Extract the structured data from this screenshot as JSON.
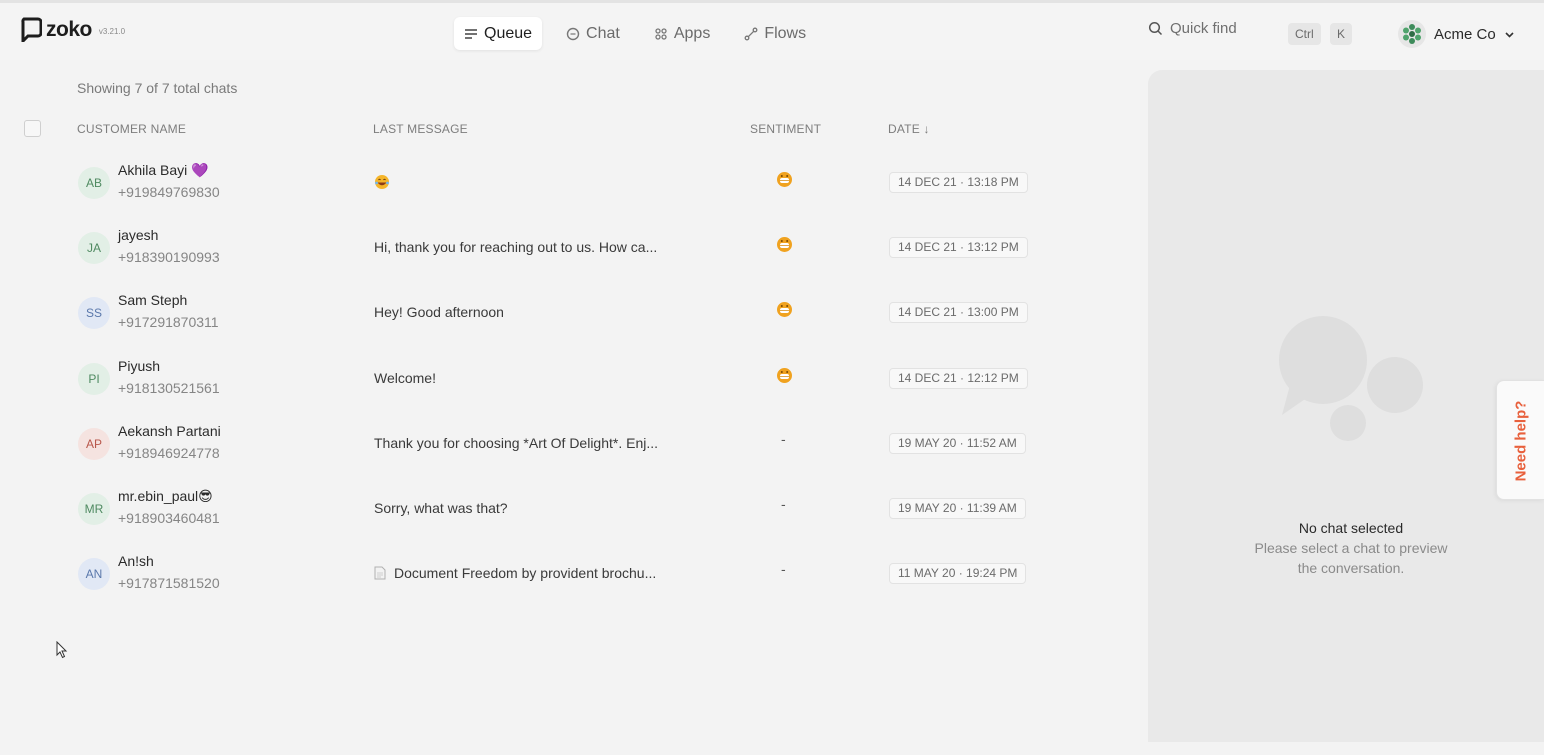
{
  "brand": {
    "name": "zoko",
    "version": "v3.21.0"
  },
  "nav": {
    "tabs": [
      {
        "label": "Queue",
        "icon": "list-icon",
        "active": true
      },
      {
        "label": "Chat",
        "icon": "chat-bubble-icon",
        "active": false
      },
      {
        "label": "Apps",
        "icon": "apps-grid-icon",
        "active": false
      },
      {
        "label": "Flows",
        "icon": "flows-icon",
        "active": false
      }
    ]
  },
  "search": {
    "label": "Quick find",
    "key_ctrl": "Ctrl",
    "key_k": "K"
  },
  "org": {
    "name": "Acme Co"
  },
  "list": {
    "showing": "Showing 7 of 7 total chats",
    "headers": {
      "customer": "CUSTOMER NAME",
      "last_message": "LAST MESSAGE",
      "sentiment": "SENTIMENT",
      "date": "DATE ↓"
    },
    "rows": [
      {
        "initials": "AB",
        "name": "Akhila Bayi 💜",
        "phone": "+919849769830",
        "message": "",
        "message_emoji": "laughing-emoji",
        "sentiment": "positive",
        "date": "14 DEC 21 · 13:18 PM",
        "avatar_bg": "#e2efe6",
        "avatar_fg": "#4f8a61"
      },
      {
        "initials": "JA",
        "name": "jayesh",
        "phone": "+918390190993",
        "message": "Hi, thank you for reaching out to us. How ca...",
        "sentiment": "positive",
        "date": "14 DEC 21 · 13:12 PM",
        "avatar_bg": "#e2efe6",
        "avatar_fg": "#4f8a61"
      },
      {
        "initials": "SS",
        "name": "Sam Steph",
        "phone": "+917291870311",
        "message": "Hey! Good afternoon",
        "sentiment": "positive",
        "date": "14 DEC 21 · 13:00 PM",
        "avatar_bg": "#e1e8f5",
        "avatar_fg": "#5a78ab"
      },
      {
        "initials": "PI",
        "name": "Piyush",
        "phone": "+918130521561",
        "message": "Welcome!",
        "sentiment": "positive",
        "date": "14 DEC 21 · 12:12 PM",
        "avatar_bg": "#e2efe6",
        "avatar_fg": "#4f8a61"
      },
      {
        "initials": "AP",
        "name": "Aekansh Partani",
        "phone": "+918946924778",
        "message": "Thank you for choosing *Art Of Delight*. Enj...",
        "sentiment": "-",
        "date": "19 MAY 20 · 11:52 AM",
        "avatar_bg": "#f5e3e0",
        "avatar_fg": "#b8574b"
      },
      {
        "initials": "MR",
        "name": "mr.ebin_paul😎",
        "phone": "+918903460481",
        "message": "Sorry, what was that?",
        "sentiment": "-",
        "date": "19 MAY 20 · 11:39 AM",
        "avatar_bg": "#e2efe6",
        "avatar_fg": "#4f8a61"
      },
      {
        "initials": "AN",
        "name": "An!sh",
        "phone": "+917871581520",
        "message": "Document Freedom by provident brochu...",
        "message_icon": "document-icon",
        "sentiment": "-",
        "date": "11 MAY 20 · 19:24 PM",
        "avatar_bg": "#e1e8f5",
        "avatar_fg": "#5a78ab"
      }
    ]
  },
  "preview": {
    "title": "No chat selected",
    "subtitle": "Please select a chat to preview the conversation."
  },
  "help": {
    "label": "Need help?"
  },
  "colors": {
    "accent": "#e8603c",
    "sentiment_positive": "#f0a21f"
  }
}
